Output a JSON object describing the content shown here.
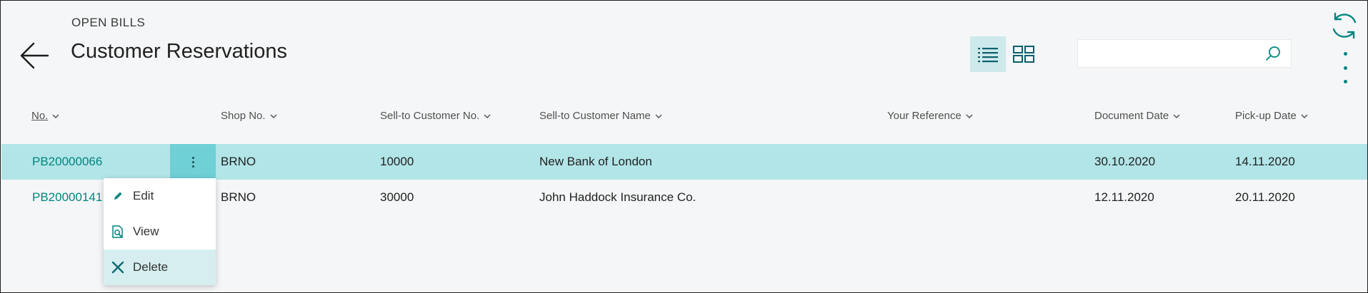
{
  "header": {
    "caption": "OPEN BILLS",
    "title": "Customer Reservations"
  },
  "search": {
    "value": "",
    "placeholder": ""
  },
  "columns": [
    {
      "label": "No."
    },
    {
      "label": "Shop No."
    },
    {
      "label": "Sell-to Customer No."
    },
    {
      "label": "Sell-to Customer Name"
    },
    {
      "label": "Your Reference"
    },
    {
      "label": "Document Date"
    },
    {
      "label": "Pick-up Date"
    }
  ],
  "rows": [
    {
      "no": "PB20000066",
      "shop_no": "BRNO",
      "customer_no": "10000",
      "customer_name": "New Bank of London",
      "your_reference": "",
      "document_date": "30.10.2020",
      "pickup_date": "14.11.2020"
    },
    {
      "no": "PB20000141",
      "shop_no": "BRNO",
      "customer_no": "30000",
      "customer_name": "John Haddock Insurance Co.",
      "your_reference": "",
      "document_date": "12.11.2020",
      "pickup_date": "20.11.2020"
    }
  ],
  "context_menu": {
    "items": [
      {
        "label": "Edit",
        "icon": "pencil-icon"
      },
      {
        "label": "View",
        "icon": "view-document-icon"
      },
      {
        "label": "Delete",
        "icon": "x-icon"
      }
    ]
  },
  "colors": {
    "accent": "#00857f",
    "selected_row": "#b2e5e8",
    "row_menu_button": "#6fd0d6",
    "active_view_toggle": "#cde9ec",
    "hovered_menu_item": "#d6eef0"
  },
  "icons": {
    "back": "back-arrow-icon",
    "list_view": "list-view-icon",
    "tile_view": "tile-view-icon",
    "search": "search-icon",
    "refresh": "refresh-icon",
    "more": "more-vertical-icon",
    "sort": "chevron-down-icon"
  }
}
